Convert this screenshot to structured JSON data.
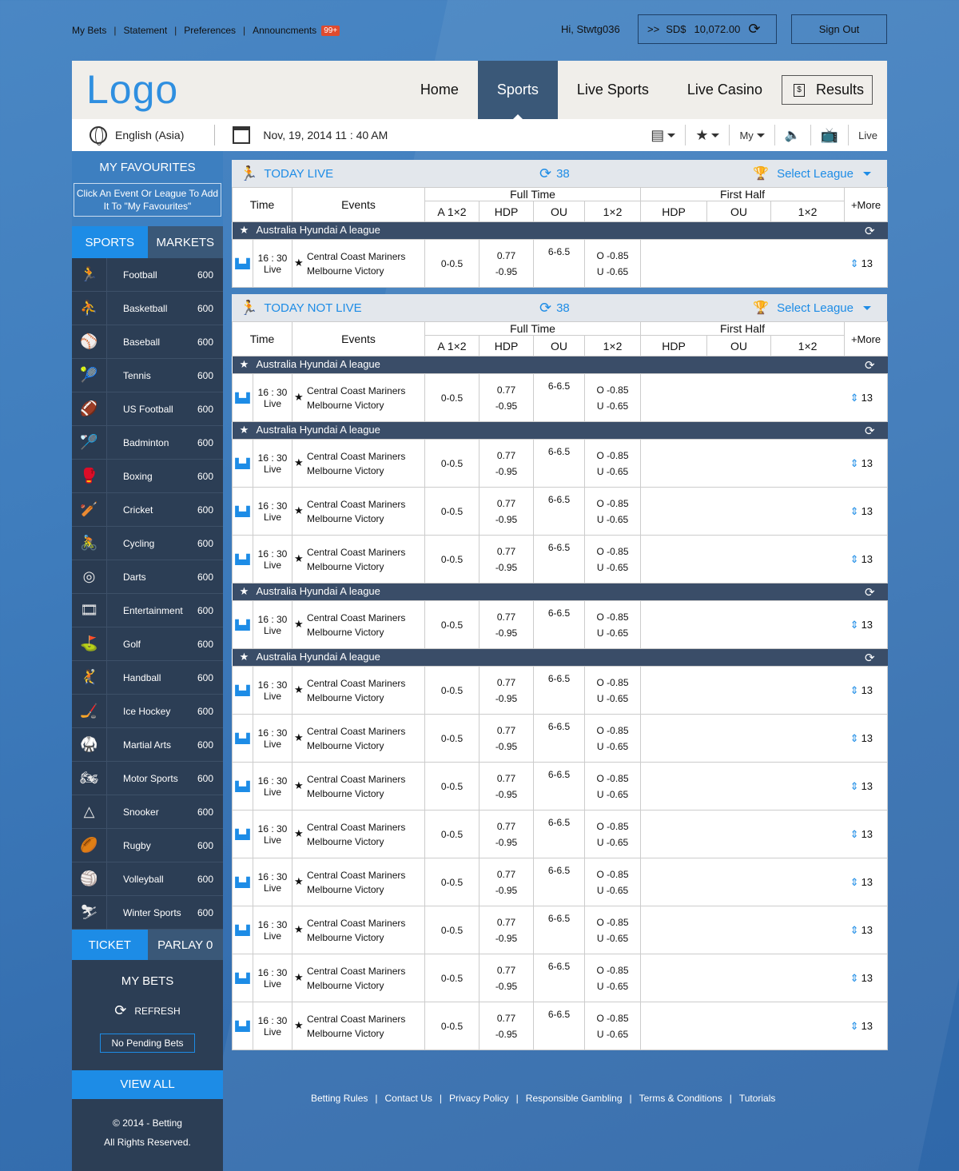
{
  "top": {
    "links": [
      "My Bets",
      "Statement",
      "Preferences",
      "Announcments"
    ],
    "badge": "99+",
    "greeting": "Hi, Stwtg036",
    "balance_prefix": ">>",
    "currency": "SD$",
    "balance": "10,072.00",
    "signout": "Sign Out"
  },
  "header": {
    "logo": "Logo",
    "nav": [
      "Home",
      "Sports",
      "Live Sports",
      "Live Casino"
    ],
    "active_nav": "Sports",
    "results": "Results"
  },
  "subbar": {
    "language": "English (Asia)",
    "datetime": "Nov, 19, 2014 11 : 40 AM",
    "my": "My",
    "live": "Live"
  },
  "sidebar": {
    "fav_title": "MY FAVOURITES",
    "fav_hint": "Click An Event Or League To Add It To \"My Favourites\"",
    "tabs": [
      "SPORTS",
      "MARKETS"
    ],
    "sports": [
      {
        "name": "Football",
        "count": "600",
        "icon": "football-icon",
        "glyph": "🏃"
      },
      {
        "name": "Basketball",
        "count": "600",
        "icon": "basketball-icon",
        "glyph": "⛹"
      },
      {
        "name": "Baseball",
        "count": "600",
        "icon": "baseball-icon",
        "glyph": "⚾"
      },
      {
        "name": "Tennis",
        "count": "600",
        "icon": "tennis-icon",
        "glyph": "🎾"
      },
      {
        "name": "US Football",
        "count": "600",
        "icon": "us-football-icon",
        "glyph": "🏈"
      },
      {
        "name": "Badminton",
        "count": "600",
        "icon": "badminton-icon",
        "glyph": "🏸"
      },
      {
        "name": "Boxing",
        "count": "600",
        "icon": "boxing-icon",
        "glyph": "🥊"
      },
      {
        "name": "Cricket",
        "count": "600",
        "icon": "cricket-icon",
        "glyph": "🏏"
      },
      {
        "name": "Cycling",
        "count": "600",
        "icon": "cycling-icon",
        "glyph": "🚴"
      },
      {
        "name": "Darts",
        "count": "600",
        "icon": "darts-icon",
        "glyph": "◎"
      },
      {
        "name": "Entertainment",
        "count": "600",
        "icon": "entertainment-icon",
        "glyph": "🎞"
      },
      {
        "name": "Golf",
        "count": "600",
        "icon": "golf-icon",
        "glyph": "⛳"
      },
      {
        "name": "Handball",
        "count": "600",
        "icon": "handball-icon",
        "glyph": "🤾"
      },
      {
        "name": "Ice Hockey",
        "count": "600",
        "icon": "ice-hockey-icon",
        "glyph": "🏒"
      },
      {
        "name": "Martial Arts",
        "count": "600",
        "icon": "martial-arts-icon",
        "glyph": "🥋"
      },
      {
        "name": "Motor Sports",
        "count": "600",
        "icon": "motor-sports-icon",
        "glyph": "🏍"
      },
      {
        "name": "Snooker",
        "count": "600",
        "icon": "snooker-icon",
        "glyph": "△"
      },
      {
        "name": "Rugby",
        "count": "600",
        "icon": "rugby-icon",
        "glyph": "🏉"
      },
      {
        "name": "Volleyball",
        "count": "600",
        "icon": "volleyball-icon",
        "glyph": "🏐"
      },
      {
        "name": "Winter Sports",
        "count": "600",
        "icon": "winter-sports-icon",
        "glyph": "⛷"
      }
    ],
    "ticket": "TICKET",
    "parlay": "PARLAY 0",
    "mybets": "MY BETS",
    "refresh": "REFRESH",
    "no_pending": "No Pending Bets",
    "view_all": "VIEW ALL",
    "copyright": "© 2014 - Betting",
    "rights": "All Rights Reserved."
  },
  "columns": {
    "time": "Time",
    "events": "Events",
    "full_time": "Full Time",
    "first_half": "First Half",
    "a12": "A 1×2",
    "hdp": "HDP",
    "ou": "OU",
    "x12": "1×2",
    "more": "+More"
  },
  "event": {
    "time": "16 : 30",
    "status": "Live",
    "home": "Central Coast Mariners",
    "away": "Melbourne Victory",
    "hdp_line": "0-0.5",
    "hdp_home": "0.77",
    "hdp_away": "-0.95",
    "ou_line": "6-6.5",
    "ou_over": "O  -0.85",
    "ou_under": "U  -0.65",
    "more_count": "13"
  },
  "today_live": {
    "title": "TODAY LIVE",
    "count": "38",
    "select": "Select League",
    "groups": [
      {
        "league": "Australia Hyundai A league",
        "events": 1
      }
    ]
  },
  "today_not_live": {
    "title": "TODAY NOT LIVE",
    "count": "38",
    "select": "Select League",
    "groups": [
      {
        "league": "Australia Hyundai A league",
        "events": 1
      },
      {
        "league": "Australia Hyundai A league",
        "events": 3
      },
      {
        "league": "Australia Hyundai A league",
        "events": 1
      },
      {
        "league": "Australia Hyundai A league",
        "events": 8
      }
    ]
  },
  "footer": [
    "Betting Rules",
    "Contact Us",
    "Privacy Policy",
    "Responsible Gambling",
    "Terms & Conditions",
    "Tutorials"
  ],
  "colors": {
    "accent": "#1d8ce6",
    "dark": "#2c3e55",
    "league_bar": "#3a4d68",
    "badge": "#e04b2f"
  }
}
